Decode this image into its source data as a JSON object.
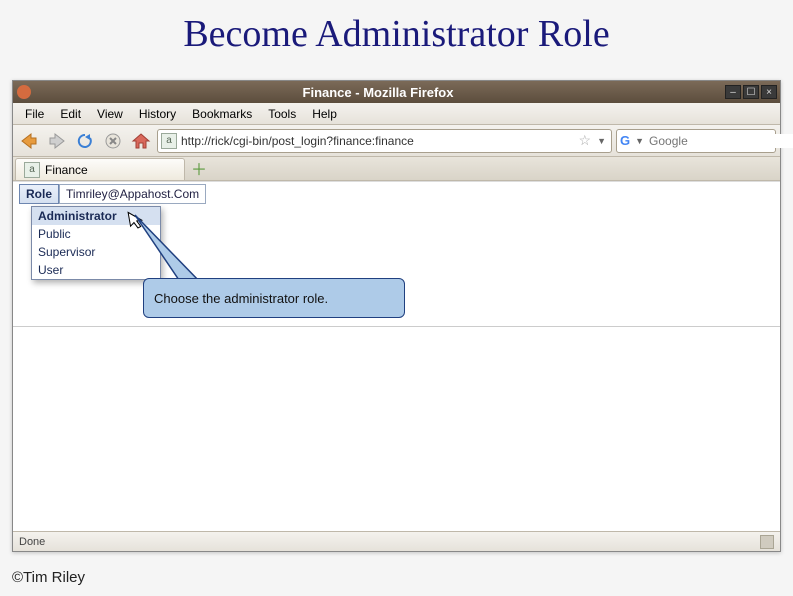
{
  "slide": {
    "title": "Become Administrator Role",
    "copyright": "©Tim Riley"
  },
  "window": {
    "title": "Finance - Mozilla Firefox",
    "controls": {
      "min": "–",
      "max": "☐",
      "close": "×"
    }
  },
  "menubar": {
    "items": [
      "File",
      "Edit",
      "View",
      "History",
      "Bookmarks",
      "Tools",
      "Help"
    ]
  },
  "toolbar": {
    "url": "http://rick/cgi-bin/post_login?finance:finance",
    "search_placeholder": "Google"
  },
  "tabs": {
    "active_label": "Finance"
  },
  "page": {
    "menus": [
      "Role",
      "Timriley@Appahost.Com"
    ],
    "dropdown_items": [
      "Administrator",
      "Public",
      "Supervisor",
      "User"
    ]
  },
  "callout": {
    "text": "Choose the administrator role."
  },
  "statusbar": {
    "text": "Done"
  }
}
